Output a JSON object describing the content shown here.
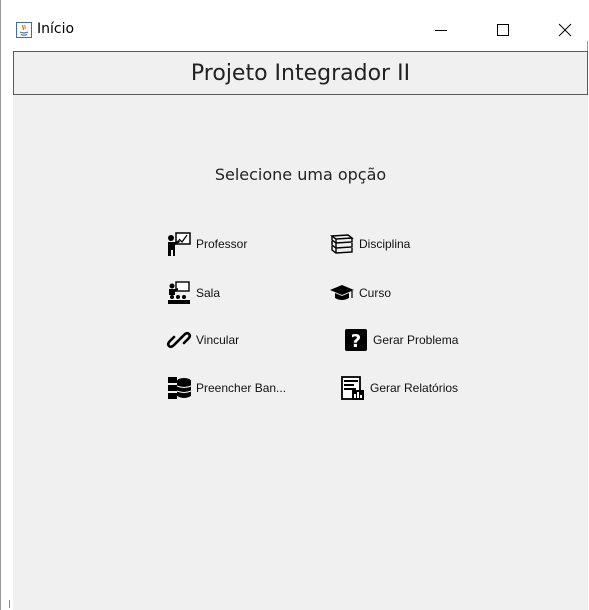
{
  "window": {
    "title": "Início"
  },
  "header": {
    "title": "Projeto Integrador II"
  },
  "prompt": "Selecione uma opção",
  "options": [
    {
      "label": "Professor",
      "icon": "teacher-icon"
    },
    {
      "label": "Disciplina",
      "icon": "books-icon"
    },
    {
      "label": "Sala",
      "icon": "classroom-icon"
    },
    {
      "label": "Curso",
      "icon": "graduation-cap-icon"
    },
    {
      "label": "Vincular",
      "icon": "link-icon"
    },
    {
      "label": "Gerar Problema",
      "icon": "question-icon"
    },
    {
      "label": "Preencher Ban...",
      "icon": "database-icon"
    },
    {
      "label": "Gerar Relatórios",
      "icon": "report-icon"
    }
  ]
}
